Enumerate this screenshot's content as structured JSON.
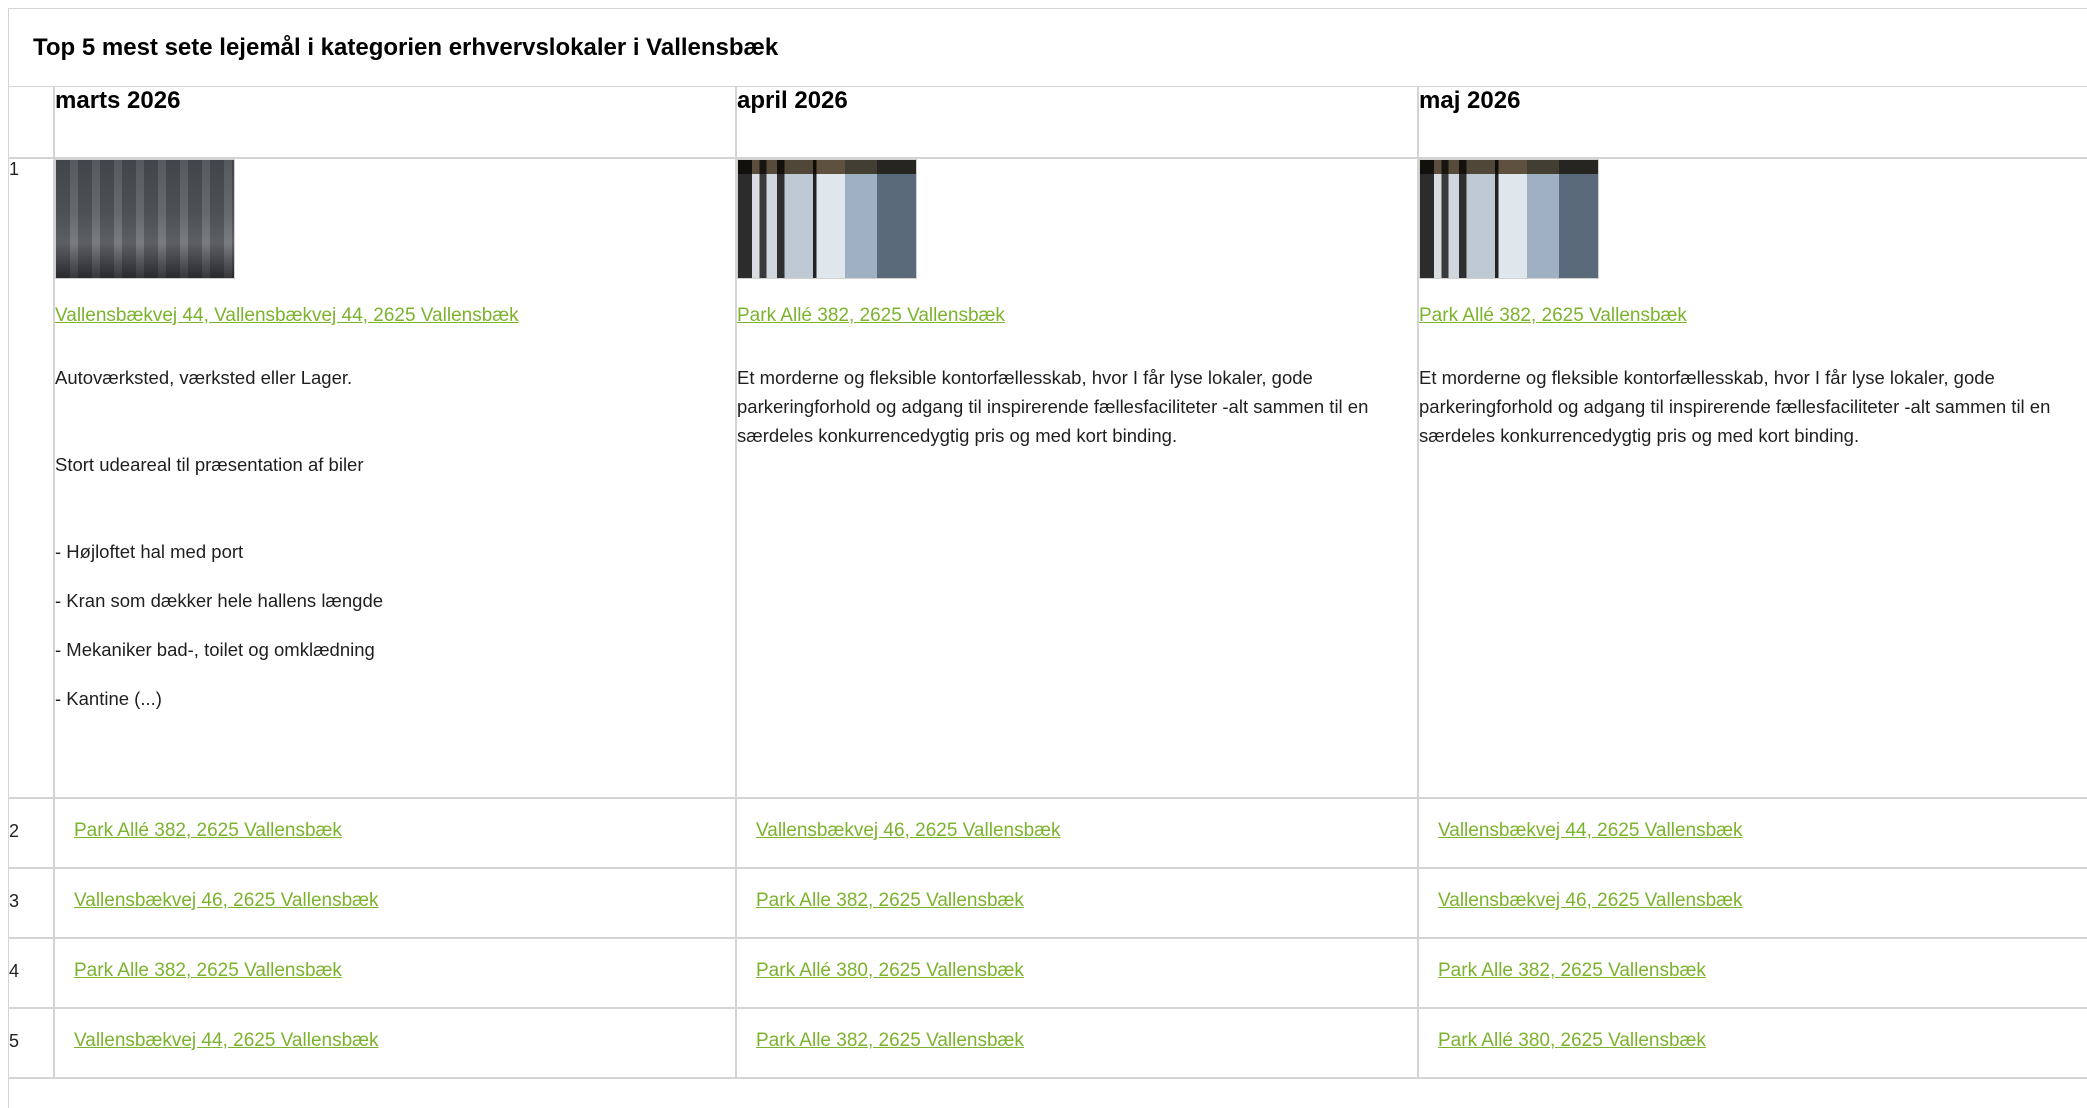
{
  "title": "Top 5 mest sete lejemål i kategorien erhvervslokaler i Vallensbæk",
  "months": [
    "marts 2026",
    "april 2026",
    "maj 2026"
  ],
  "top": {
    "rank": "1",
    "cells": [
      {
        "image": "workshop-photo",
        "address": "Vallensbækvej 44, Vallensbækvej 44, 2625 Vallensbæk",
        "lines": [
          "Autoværksted, værksted eller Lager.",
          "Stort udeareal til præsentation af biler",
          "- Højloftet hal med port",
          "- Kran som dækker hele hallens længde",
          "- Mekaniker bad-, toilet og omklædning",
          "- Kantine (...)"
        ]
      },
      {
        "image": "office-photo",
        "address": "Park Allé 382, 2625 Vallensbæk",
        "lines": [
          "Et morderne og fleksible kontorfællesskab, hvor I får lyse lokaler, gode parkeringforhold og adgang til inspirerende fællesfaciliteter -alt sammen til en særdeles konkurrencedygtig pris og med kort binding."
        ]
      },
      {
        "image": "office-photo",
        "address": "Park Allé 382, 2625 Vallensbæk",
        "lines": [
          "Et morderne og fleksible kontorfællesskab, hvor I får lyse lokaler, gode parkeringforhold og adgang til inspirerende fællesfaciliteter -alt sammen til en særdeles konkurrencedygtig pris og med kort binding."
        ]
      }
    ]
  },
  "rows": [
    {
      "rank": "2",
      "addresses": [
        "Park Allé 382, 2625 Vallensbæk",
        "Vallensbækvej 46, 2625 Vallensbæk",
        "Vallensbækvej 44, 2625 Vallensbæk"
      ]
    },
    {
      "rank": "3",
      "addresses": [
        "Vallensbækvej 46, 2625 Vallensbæk",
        "Park Alle 382, 2625 Vallensbæk",
        "Vallensbækvej 46, 2625 Vallensbæk"
      ]
    },
    {
      "rank": "4",
      "addresses": [
        "Park Alle 382, 2625 Vallensbæk",
        "Park Allé 380, 2625 Vallensbæk",
        "Park Alle 382, 2625 Vallensbæk"
      ]
    },
    {
      "rank": "5",
      "addresses": [
        "Vallensbækvej 44, 2625 Vallensbæk",
        "Park Alle 382, 2625 Vallensbæk",
        "Park Allé 380, 2625 Vallensbæk"
      ]
    }
  ],
  "colors": {
    "link": "#7cb32d",
    "border": "#d4d4d4"
  }
}
